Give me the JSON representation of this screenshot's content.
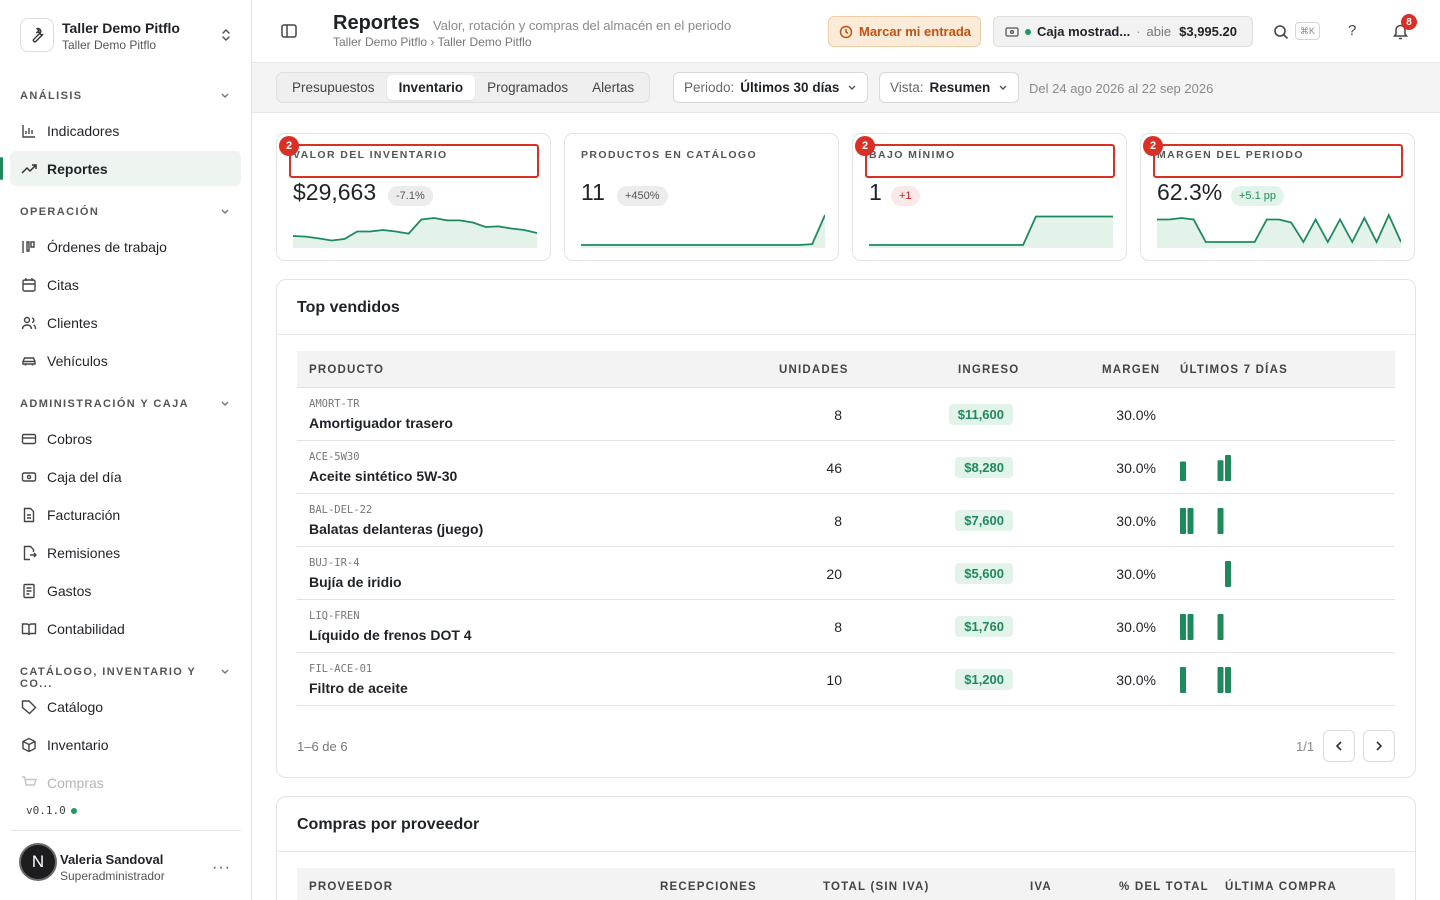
{
  "workspace": {
    "name": "Taller Demo Pitflo",
    "subtitle": "Taller Demo Pitflo"
  },
  "sidebar": {
    "sections": [
      {
        "label": "ANÁLISIS"
      },
      {
        "label": "OPERACIÓN"
      },
      {
        "label": "ADMINISTRACIÓN Y CAJA"
      },
      {
        "label": "CATÁLOGO, INVENTARIO Y CO..."
      }
    ],
    "items": [
      {
        "label": "Indicadores",
        "icon": "bar-chart-icon"
      },
      {
        "label": "Reportes",
        "icon": "trending-up-icon",
        "active": true
      },
      {
        "label": "Órdenes de trabajo",
        "icon": "kanban-icon"
      },
      {
        "label": "Citas",
        "icon": "calendar-icon"
      },
      {
        "label": "Clientes",
        "icon": "users-icon"
      },
      {
        "label": "Vehículos",
        "icon": "car-icon"
      },
      {
        "label": "Cobros",
        "icon": "credit-card-icon"
      },
      {
        "label": "Caja del día",
        "icon": "cash-register-icon"
      },
      {
        "label": "Facturación",
        "icon": "invoice-icon"
      },
      {
        "label": "Remisiones",
        "icon": "file-export-icon"
      },
      {
        "label": "Gastos",
        "icon": "receipt-icon"
      },
      {
        "label": "Contabilidad",
        "icon": "book-icon"
      },
      {
        "label": "Catálogo",
        "icon": "tag-icon"
      },
      {
        "label": "Inventario",
        "icon": "box-icon"
      },
      {
        "label": "Compras",
        "icon": "cart-icon"
      }
    ],
    "version": "v0.1.0"
  },
  "user": {
    "initial": "N",
    "name": "Valeria Sandoval",
    "role": "Superadministrador"
  },
  "header": {
    "title": "Reportes",
    "subtitle": "Valor, rotación y compras del almacén en el periodo",
    "breadcrumb": "Taller Demo Pitflo › Taller Demo Pitflo",
    "entrada_label": "Marcar mi entrada",
    "caja": {
      "name": "Caja mostrad...",
      "sep": "·",
      "status": "abie",
      "amount": "$3,995.20"
    },
    "shortcut": "⌘K",
    "help": "?",
    "notifications": "8"
  },
  "toolbar": {
    "tabs": [
      "Presupuestos",
      "Inventario",
      "Programados",
      "Alertas"
    ],
    "active_tab": "Inventario",
    "periodo": {
      "label": "Periodo:",
      "value": "Últimos 30 días"
    },
    "vista": {
      "label": "Vista:",
      "value": "Resumen"
    },
    "range": "Del 24 ago 2026 al 22 sep 2026"
  },
  "kpis": [
    {
      "label": "VALOR DEL INVENTARIO",
      "value": "$29,663",
      "delta": "-7.1%",
      "tone": "gray",
      "marker": "2",
      "spark": [
        0.3,
        0.28,
        0.22,
        0.15,
        0.2,
        0.45,
        0.45,
        0.5,
        0.45,
        0.38,
        0.85,
        0.9,
        0.82,
        0.82,
        0.75,
        0.6,
        0.62,
        0.55,
        0.5,
        0.4
      ]
    },
    {
      "label": "PRODUCTOS EN CATÁLOGO",
      "value": "11",
      "delta": "+450%",
      "tone": "gray",
      "spark": [
        0,
        0,
        0,
        0,
        0,
        0,
        0,
        0,
        0,
        0,
        0,
        0,
        0,
        0,
        0,
        0,
        0,
        0,
        0.03,
        1
      ]
    },
    {
      "label": "BAJO MÍNIMO",
      "value": "1",
      "delta": "+1",
      "tone": "red",
      "marker": "2",
      "spark": [
        0,
        0,
        0,
        0,
        0,
        0,
        0,
        0,
        0,
        0,
        0,
        0,
        0,
        0.95,
        0.95,
        0.95,
        0.95,
        0.95,
        0.95,
        0.95
      ]
    },
    {
      "label": "MARGEN DEL PERIODO",
      "value": "62.3%",
      "delta": "+5.1 pp",
      "tone": "green",
      "marker": "2",
      "spark": [
        0.85,
        0.85,
        0.9,
        0.85,
        0.1,
        0.1,
        0.1,
        0.1,
        0.1,
        0.85,
        0.85,
        0.75,
        0.1,
        0.85,
        0.1,
        0.85,
        0.1,
        0.9,
        0.1,
        1,
        0.1
      ]
    }
  ],
  "top_vendidos": {
    "title": "Top vendidos",
    "columns": [
      "PRODUCTO",
      "UNIDADES",
      "INGRESO",
      "MARGEN",
      "ÚLTIMOS 7 DÍAS"
    ],
    "rows": [
      {
        "sku": "AMORT-TR",
        "name": "Amortiguador trasero",
        "units": "8",
        "revenue": "$11,600",
        "margin": "30.0%",
        "days": [
          0,
          0,
          0,
          0,
          0,
          0,
          0
        ]
      },
      {
        "sku": "ACE-5W30",
        "name": "Aceite sintético 5W-30",
        "units": "46",
        "revenue": "$8,280",
        "margin": "30.0%",
        "days": [
          0.75,
          0,
          0,
          0,
          0,
          0.8,
          1
        ]
      },
      {
        "sku": "BAL-DEL-22",
        "name": "Balatas delanteras (juego)",
        "units": "8",
        "revenue": "$7,600",
        "margin": "30.0%",
        "days": [
          1,
          1,
          0,
          0,
          0,
          1,
          0
        ]
      },
      {
        "sku": "BUJ-IR-4",
        "name": "Bujía de iridio",
        "units": "20",
        "revenue": "$5,600",
        "margin": "30.0%",
        "days": [
          0,
          0,
          0,
          0,
          0,
          0,
          1
        ]
      },
      {
        "sku": "LIQ-FREN",
        "name": "Líquido de frenos DOT 4",
        "units": "8",
        "revenue": "$1,760",
        "margin": "30.0%",
        "days": [
          1,
          1,
          0,
          0,
          0,
          1,
          0
        ]
      },
      {
        "sku": "FIL-ACE-01",
        "name": "Filtro de aceite",
        "units": "10",
        "revenue": "$1,200",
        "margin": "30.0%",
        "days": [
          1,
          0,
          0,
          0,
          0,
          1,
          1
        ]
      }
    ],
    "count_label": "1–6 de 6",
    "page_label": "1/1"
  },
  "compras": {
    "title": "Compras por proveedor",
    "columns": [
      "PROVEEDOR",
      "RECEPCIONES",
      "TOTAL (SIN IVA)",
      "IVA",
      "% DEL TOTAL",
      "ÚLTIMA COMPRA"
    ]
  },
  "colors": {
    "accent": "#1e8a5c",
    "alert": "#d93025",
    "warning": "#c4510e"
  }
}
